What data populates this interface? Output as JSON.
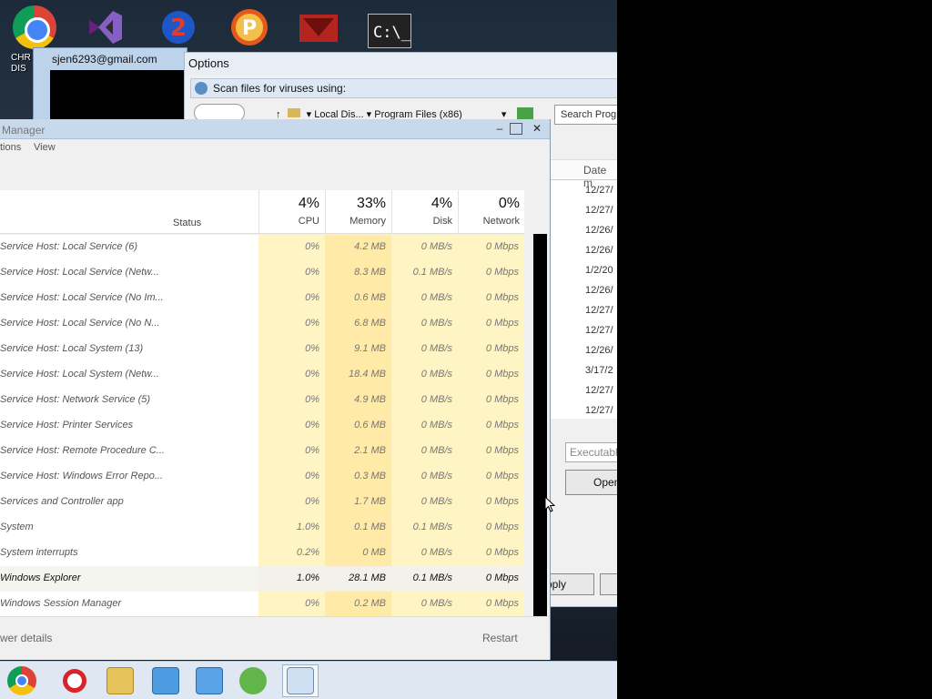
{
  "desktop": {
    "icons": [
      {
        "name": "chrome-icon",
        "label": "CHR\nDIS"
      },
      {
        "name": "visual-studio-icon"
      },
      {
        "name": "app-2-icon"
      },
      {
        "name": "app-p-icon"
      },
      {
        "name": "app-red-icon"
      },
      {
        "name": "command-prompt-icon"
      }
    ],
    "chrome_label_1": "CHR",
    "chrome_label_2": "DIS"
  },
  "email_window": {
    "account": "sjen6293@gmail.com"
  },
  "options_dialog": {
    "title": "Options",
    "scan_label": "Scan files for viruses using:",
    "breadcrumb_1": "▾ Local Dis... ▾",
    "breadcrumb_2": "Program Files (x86)",
    "search_placeholder": "Search Prog",
    "date_header": "Date m",
    "dates": [
      "12/27/",
      "12/27/",
      "12/26/",
      "12/26/",
      "1/2/20",
      "12/26/",
      "12/27/",
      "12/27/",
      "12/26/",
      "3/17/2",
      "12/27/",
      "12/27/"
    ],
    "executable_placeholder": "Executabl",
    "open_label": "Open",
    "apply_label": "pply"
  },
  "task_manager": {
    "title": "Manager",
    "menu": [
      "tions",
      "View"
    ],
    "columns": {
      "status": "Status",
      "cpu": {
        "pct": "4%",
        "label": "CPU"
      },
      "memory": {
        "pct": "33%",
        "label": "Memory"
      },
      "disk": {
        "pct": "4%",
        "label": "Disk"
      },
      "network": {
        "pct": "0%",
        "label": "Network"
      }
    },
    "processes": [
      {
        "name": "Service Host: Local Service (6)",
        "cpu": "0%",
        "memory": "4.2 MB",
        "disk": "0 MB/s",
        "network": "0 Mbps"
      },
      {
        "name": "Service Host: Local Service (Netw...",
        "cpu": "0%",
        "memory": "8.3 MB",
        "disk": "0.1 MB/s",
        "network": "0 Mbps"
      },
      {
        "name": "Service Host: Local Service (No Im...",
        "cpu": "0%",
        "memory": "0.6 MB",
        "disk": "0 MB/s",
        "network": "0 Mbps"
      },
      {
        "name": "Service Host: Local Service (No N...",
        "cpu": "0%",
        "memory": "6.8 MB",
        "disk": "0 MB/s",
        "network": "0 Mbps"
      },
      {
        "name": "Service Host: Local System (13)",
        "cpu": "0%",
        "memory": "9.1 MB",
        "disk": "0 MB/s",
        "network": "0 Mbps"
      },
      {
        "name": "Service Host: Local System (Netw...",
        "cpu": "0%",
        "memory": "18.4 MB",
        "disk": "0 MB/s",
        "network": "0 Mbps"
      },
      {
        "name": "Service Host: Network Service (5)",
        "cpu": "0%",
        "memory": "4.9 MB",
        "disk": "0 MB/s",
        "network": "0 Mbps"
      },
      {
        "name": "Service Host: Printer Services",
        "cpu": "0%",
        "memory": "0.6 MB",
        "disk": "0 MB/s",
        "network": "0 Mbps"
      },
      {
        "name": "Service Host: Remote Procedure C...",
        "cpu": "0%",
        "memory": "2.1 MB",
        "disk": "0 MB/s",
        "network": "0 Mbps"
      },
      {
        "name": "Service Host: Windows Error Repo...",
        "cpu": "0%",
        "memory": "0.3 MB",
        "disk": "0 MB/s",
        "network": "0 Mbps"
      },
      {
        "name": "Services and Controller app",
        "cpu": "0%",
        "memory": "1.7 MB",
        "disk": "0 MB/s",
        "network": "0 Mbps"
      },
      {
        "name": "System",
        "cpu": "1.0%",
        "memory": "0.1 MB",
        "disk": "0.1 MB/s",
        "network": "0 Mbps"
      },
      {
        "name": "System interrupts",
        "cpu": "0.2%",
        "memory": "0 MB",
        "disk": "0 MB/s",
        "network": "0 Mbps"
      },
      {
        "name": "Windows Explorer",
        "cpu": "1.0%",
        "memory": "28.1 MB",
        "disk": "0.1 MB/s",
        "network": "0 Mbps",
        "highlight": true
      },
      {
        "name": "Windows Session Manager",
        "cpu": "0%",
        "memory": "0.2 MB",
        "disk": "0 MB/s",
        "network": "0 Mbps"
      }
    ],
    "fewer_details": "wer details",
    "restart": "Restart"
  },
  "taskbar": {
    "items": [
      "chrome-taskbar-icon",
      "opera-taskbar-icon",
      "file-explorer-taskbar-icon",
      "installer-taskbar-icon",
      "installer2-taskbar-icon",
      "messenger-taskbar-icon",
      "task-manager-taskbar-icon"
    ]
  },
  "colors": {
    "cpu_cell": "#fff4c4",
    "memory_cell": "#ffeaa8",
    "disk_cell": "#fff4c4",
    "network_cell": "#fff4c4"
  }
}
